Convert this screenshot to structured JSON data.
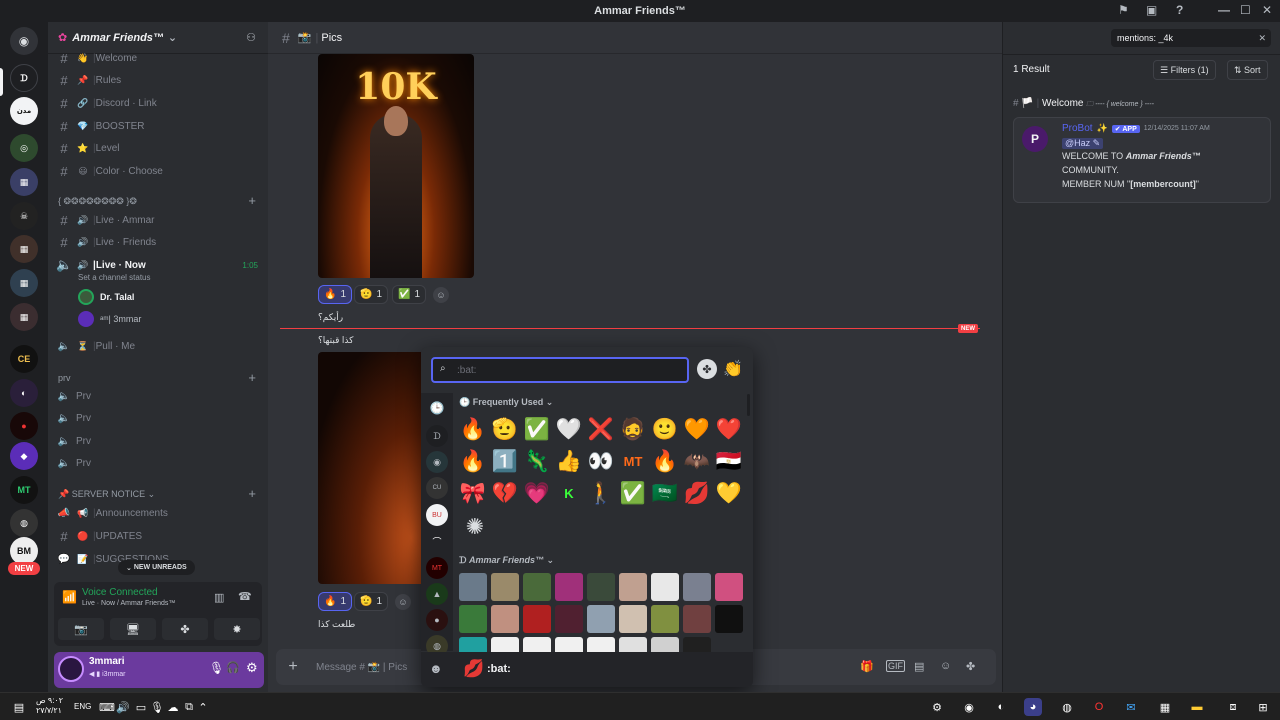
{
  "window": {
    "title": "Ammar Friends™"
  },
  "server": {
    "name": "Ammar Friends™",
    "channels": [
      {
        "emoji": "👋",
        "label": "Welcome",
        "active": false
      },
      {
        "emoji": "📌",
        "label": "Rules",
        "active": false
      },
      {
        "emoji": "🔗",
        "label": "Discord · Link",
        "active": false
      },
      {
        "emoji": "💎",
        "label": "BOOSTER",
        "active": false
      },
      {
        "emoji": "⭐",
        "label": "Level",
        "active": false
      },
      {
        "emoji": "😃",
        "label": "Color · Choose",
        "active": false
      }
    ],
    "voice_category": "{ ❂❂❂❂❂❂❂❂ }❂",
    "voice_channels": [
      {
        "label": "Live · Ammar",
        "active": false
      },
      {
        "label": "Live · Friends",
        "active": false
      },
      {
        "label": "Live · Now",
        "active": true,
        "time": "1:05",
        "status": "Set a channel status"
      }
    ],
    "voice_users": [
      {
        "name": "Dr. Talal"
      },
      {
        "name": "ᵃᵐ| 3mmar"
      }
    ],
    "pull_channel": "Pull · Me",
    "prv_category": "prv",
    "prv_channels": [
      "Prv",
      "Prv",
      "Prv",
      "Prv"
    ],
    "notice_category": "SERVER NOTICE",
    "notice_channels": [
      {
        "emoji": "📢",
        "label": "Announcements"
      },
      {
        "emoji": "🔴",
        "label": "UPDATES"
      },
      {
        "emoji": "📝",
        "label": "SUGGESTIONS"
      }
    ],
    "new_unreads": "NEW UNREADS"
  },
  "rail": {
    "new_badge": "NEW"
  },
  "voice": {
    "status": "Voice Connected",
    "location": "Live · Now / Ammar Friends™"
  },
  "user": {
    "name": "3mmari",
    "tag": "i3mmar"
  },
  "channel": {
    "name": "Pics"
  },
  "messages": [
    {
      "reactions": [
        {
          "emoji": "🔥",
          "count": "1",
          "me": true
        },
        {
          "emoji": "🫡",
          "count": "1",
          "me": false
        },
        {
          "emoji": "✅",
          "count": "1",
          "me": false
        }
      ],
      "caption": "رأيكم؟"
    },
    {
      "text": "كذا قبتها؟",
      "reactions": [
        {
          "emoji": "🔥",
          "count": "1",
          "me": true
        },
        {
          "emoji": "🫡",
          "count": "1",
          "me": false
        }
      ],
      "caption": "طلعت كذا"
    }
  ],
  "image_text": "10K",
  "new_divider": "NEW",
  "composer": {
    "placeholder": "Message # 📸 | Pics"
  },
  "picker": {
    "search_value": ":bat:",
    "frequently_used": "Frequently Used",
    "server_section": "Ammar Friends™",
    "emoji_rows": [
      [
        "🔥",
        "🫡",
        "✅",
        "🤍",
        "❌",
        "🧔",
        "🙂",
        "🧡",
        "❤️"
      ],
      [
        "🔥",
        "1️⃣",
        "🦎",
        "👍",
        "👀",
        "MT",
        "🔥",
        "🦇",
        "🇪🇬"
      ],
      [
        "🎀",
        "💔",
        "💗",
        "K",
        "🚶",
        "✅",
        "🇸🇦",
        "💋",
        "💛"
      ]
    ],
    "footer_label": ":bat:",
    "footer_emoji": "💋"
  },
  "search_panel": {
    "query": "mentions: _4k",
    "result_count": "1 Result",
    "filters": "Filters (1)",
    "sort": "Sort",
    "channel": "Welcome",
    "channel_suffix": "---- { welcome } ----",
    "author": "ProBot",
    "badge": "APP",
    "timestamp": "12/14/2025 11:07 AM",
    "mention": "@Haz",
    "line1_pre": "WELCOME TO",
    "line1_server": "Ammar Friends™",
    "line2": "COMMUNITY.",
    "line3_pre": "MEMBER NUM \"",
    "line3_var": "[membercount]",
    "line3_post": "\""
  },
  "taskbar": {
    "lang": "ENG",
    "time": "٩:٠٢ ص",
    "date": "٢٧/٧/٢١"
  },
  "colors": {
    "accent": "#5865f2",
    "online": "#23a55a",
    "new": "#f23f43",
    "user_bar": "#6b3a9e",
    "bot": "#5865f2"
  }
}
